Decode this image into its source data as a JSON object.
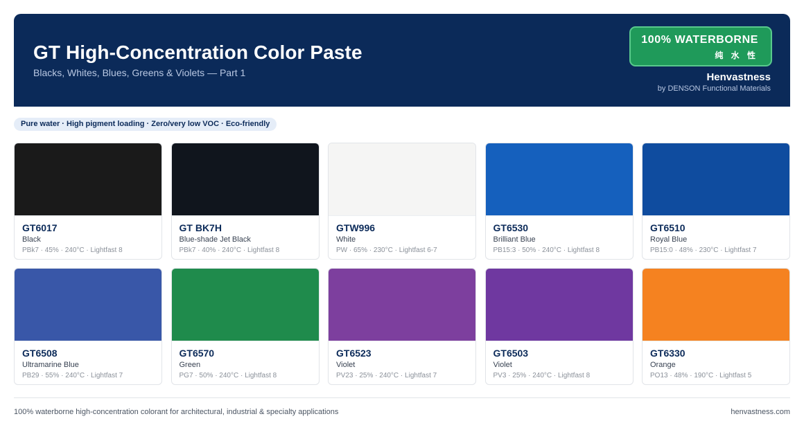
{
  "header": {
    "title": "GT High-Concentration Color Paste",
    "subtitle": "Blacks, Whites, Blues, Greens & Violets — Part 1",
    "badge_main": "100% WATERBORNE",
    "badge_sub": "纯 水 性",
    "brand": "Henvastness",
    "brand_sub": "by DENSON Functional Materials"
  },
  "tagline": "Pure water · High pigment loading · Zero/very low VOC · Eco-friendly",
  "products": [
    {
      "code": "GT6017",
      "name": "Black",
      "spec": "PBk7 · 45% · 240°C · Lightfast 8",
      "color": "#1a1a1a"
    },
    {
      "code": "GT BK7H",
      "name": "Blue-shade Jet Black",
      "spec": "PBk7 · 40% · 240°C · Lightfast 8",
      "color": "#10151d"
    },
    {
      "code": "GTW996",
      "name": "White",
      "spec": "PW · 65% · 230°C · Lightfast 6-7",
      "color": "#f5f5f4"
    },
    {
      "code": "GT6530",
      "name": "Brilliant Blue",
      "spec": "PB15:3 · 50% · 240°C · Lightfast 8",
      "color": "#1560bd"
    },
    {
      "code": "GT6510",
      "name": "Royal Blue",
      "spec": "PB15:0 · 48% · 230°C · Lightfast 7",
      "color": "#0f4c9f"
    },
    {
      "code": "GT6508",
      "name": "Ultramarine Blue",
      "spec": "PB29 · 55% · 240°C · Lightfast 7",
      "color": "#3957a8"
    },
    {
      "code": "GT6570",
      "name": "Green",
      "spec": "PG7 · 50% · 240°C · Lightfast 8",
      "color": "#1f8b4c"
    },
    {
      "code": "GT6523",
      "name": "Violet",
      "spec": "PV23 · 25% · 240°C · Lightfast 7",
      "color": "#7d3f9e"
    },
    {
      "code": "GT6503",
      "name": "Violet",
      "spec": "PV3 · 25% · 240°C · Lightfast 8",
      "color": "#6f38a0"
    },
    {
      "code": "GT6330",
      "name": "Orange",
      "spec": "PO13 · 48% · 190°C · Lightfast 5",
      "color": "#f58220"
    }
  ],
  "footer": {
    "left": "100% waterborne high-concentration colorant for architectural, industrial & specialty applications",
    "right": "henvastness.com"
  },
  "colors": {
    "header_bg": "#0b2a59",
    "badge_bg": "#1f9a5a",
    "accent_text": "#0b2a59"
  }
}
